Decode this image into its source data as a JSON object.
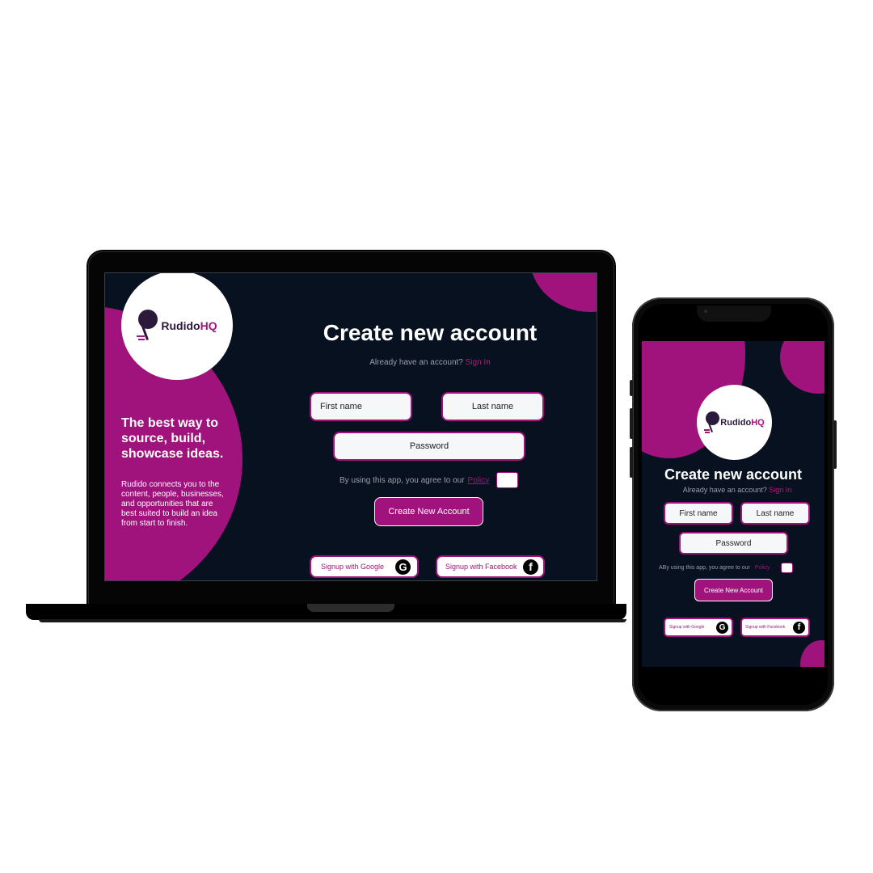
{
  "brand": {
    "name_main": "Rudido",
    "name_accent": "HQ"
  },
  "desktop": {
    "tagline": "The best way to source, build, showcase ideas.",
    "description": "Rudido connects you to the content, people, businesses, and opportunities that are best suited to build an idea from start to finish."
  },
  "form": {
    "title": "Create new account",
    "have_account_text": "Already have an account?",
    "sign_in_link": "Sign In",
    "first_name_placeholder": "First name",
    "last_name_placeholder": "Last name",
    "password_placeholder": "Password",
    "policy_text": "By using this app, you agree to our",
    "policy_link": "Policy",
    "create_button": "Create New Account",
    "google_button": "Signup with Google",
    "facebook_button": "Signup with Facebook"
  },
  "mobile": {
    "policy_text": "ABy using this app, you agree to our"
  },
  "icons": {
    "google": "google-icon",
    "facebook": "facebook-icon"
  },
  "colors": {
    "accent": "#a0137c",
    "background": "#07111f",
    "field": "#f6f7f8"
  }
}
